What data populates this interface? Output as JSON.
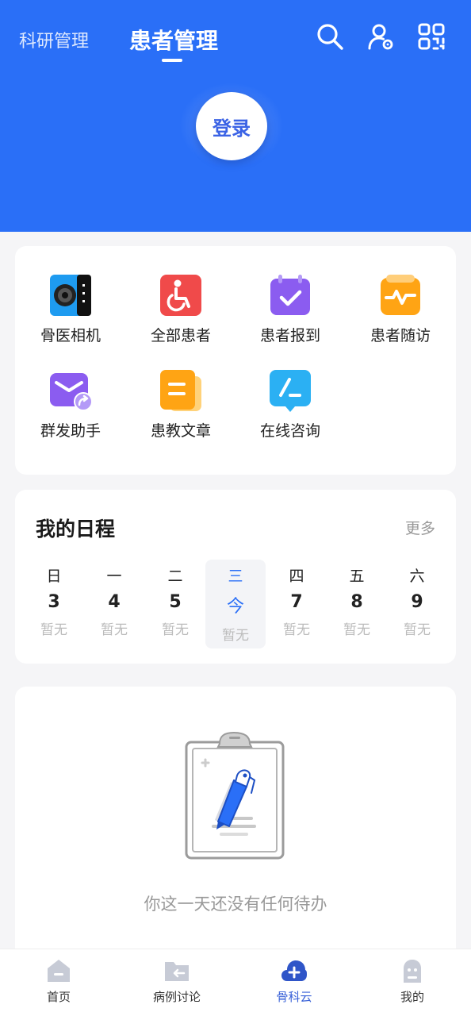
{
  "header": {
    "tabs": [
      {
        "label": "科研管理"
      },
      {
        "label": "患者管理"
      }
    ],
    "icons": [
      "search-icon",
      "user-settings-icon",
      "qr-code-icon"
    ],
    "login_label": "登录",
    "accent": "#2a6ff7"
  },
  "tools": [
    {
      "label": "骨医相机",
      "icon": "camera-icon"
    },
    {
      "label": "全部患者",
      "icon": "wheelchair-icon"
    },
    {
      "label": "患者报到",
      "icon": "calendar-check-icon"
    },
    {
      "label": "患者随访",
      "icon": "heartbeat-icon"
    },
    {
      "label": "群发助手",
      "icon": "mail-share-icon"
    },
    {
      "label": "患教文章",
      "icon": "article-icon"
    },
    {
      "label": "在线咨询",
      "icon": "chat-icon"
    }
  ],
  "schedule": {
    "title": "我的日程",
    "more": "更多",
    "days": [
      {
        "week": "日",
        "date": "3",
        "status": "暂无"
      },
      {
        "week": "一",
        "date": "4",
        "status": "暂无"
      },
      {
        "week": "二",
        "date": "5",
        "status": "暂无"
      },
      {
        "week": "三",
        "date": "今",
        "status": "暂无"
      },
      {
        "week": "四",
        "date": "7",
        "status": "暂无"
      },
      {
        "week": "五",
        "date": "8",
        "status": "暂无"
      },
      {
        "week": "六",
        "date": "9",
        "status": "暂无"
      }
    ]
  },
  "empty": {
    "text": "你这一天还没有任何待办"
  },
  "tabbar": {
    "items": [
      {
        "label": "首页",
        "icon": "home-icon"
      },
      {
        "label": "病例讨论",
        "icon": "folder-icon"
      },
      {
        "label": "骨科云",
        "icon": "cloud-icon"
      },
      {
        "label": "我的",
        "icon": "profile-icon"
      }
    ]
  }
}
